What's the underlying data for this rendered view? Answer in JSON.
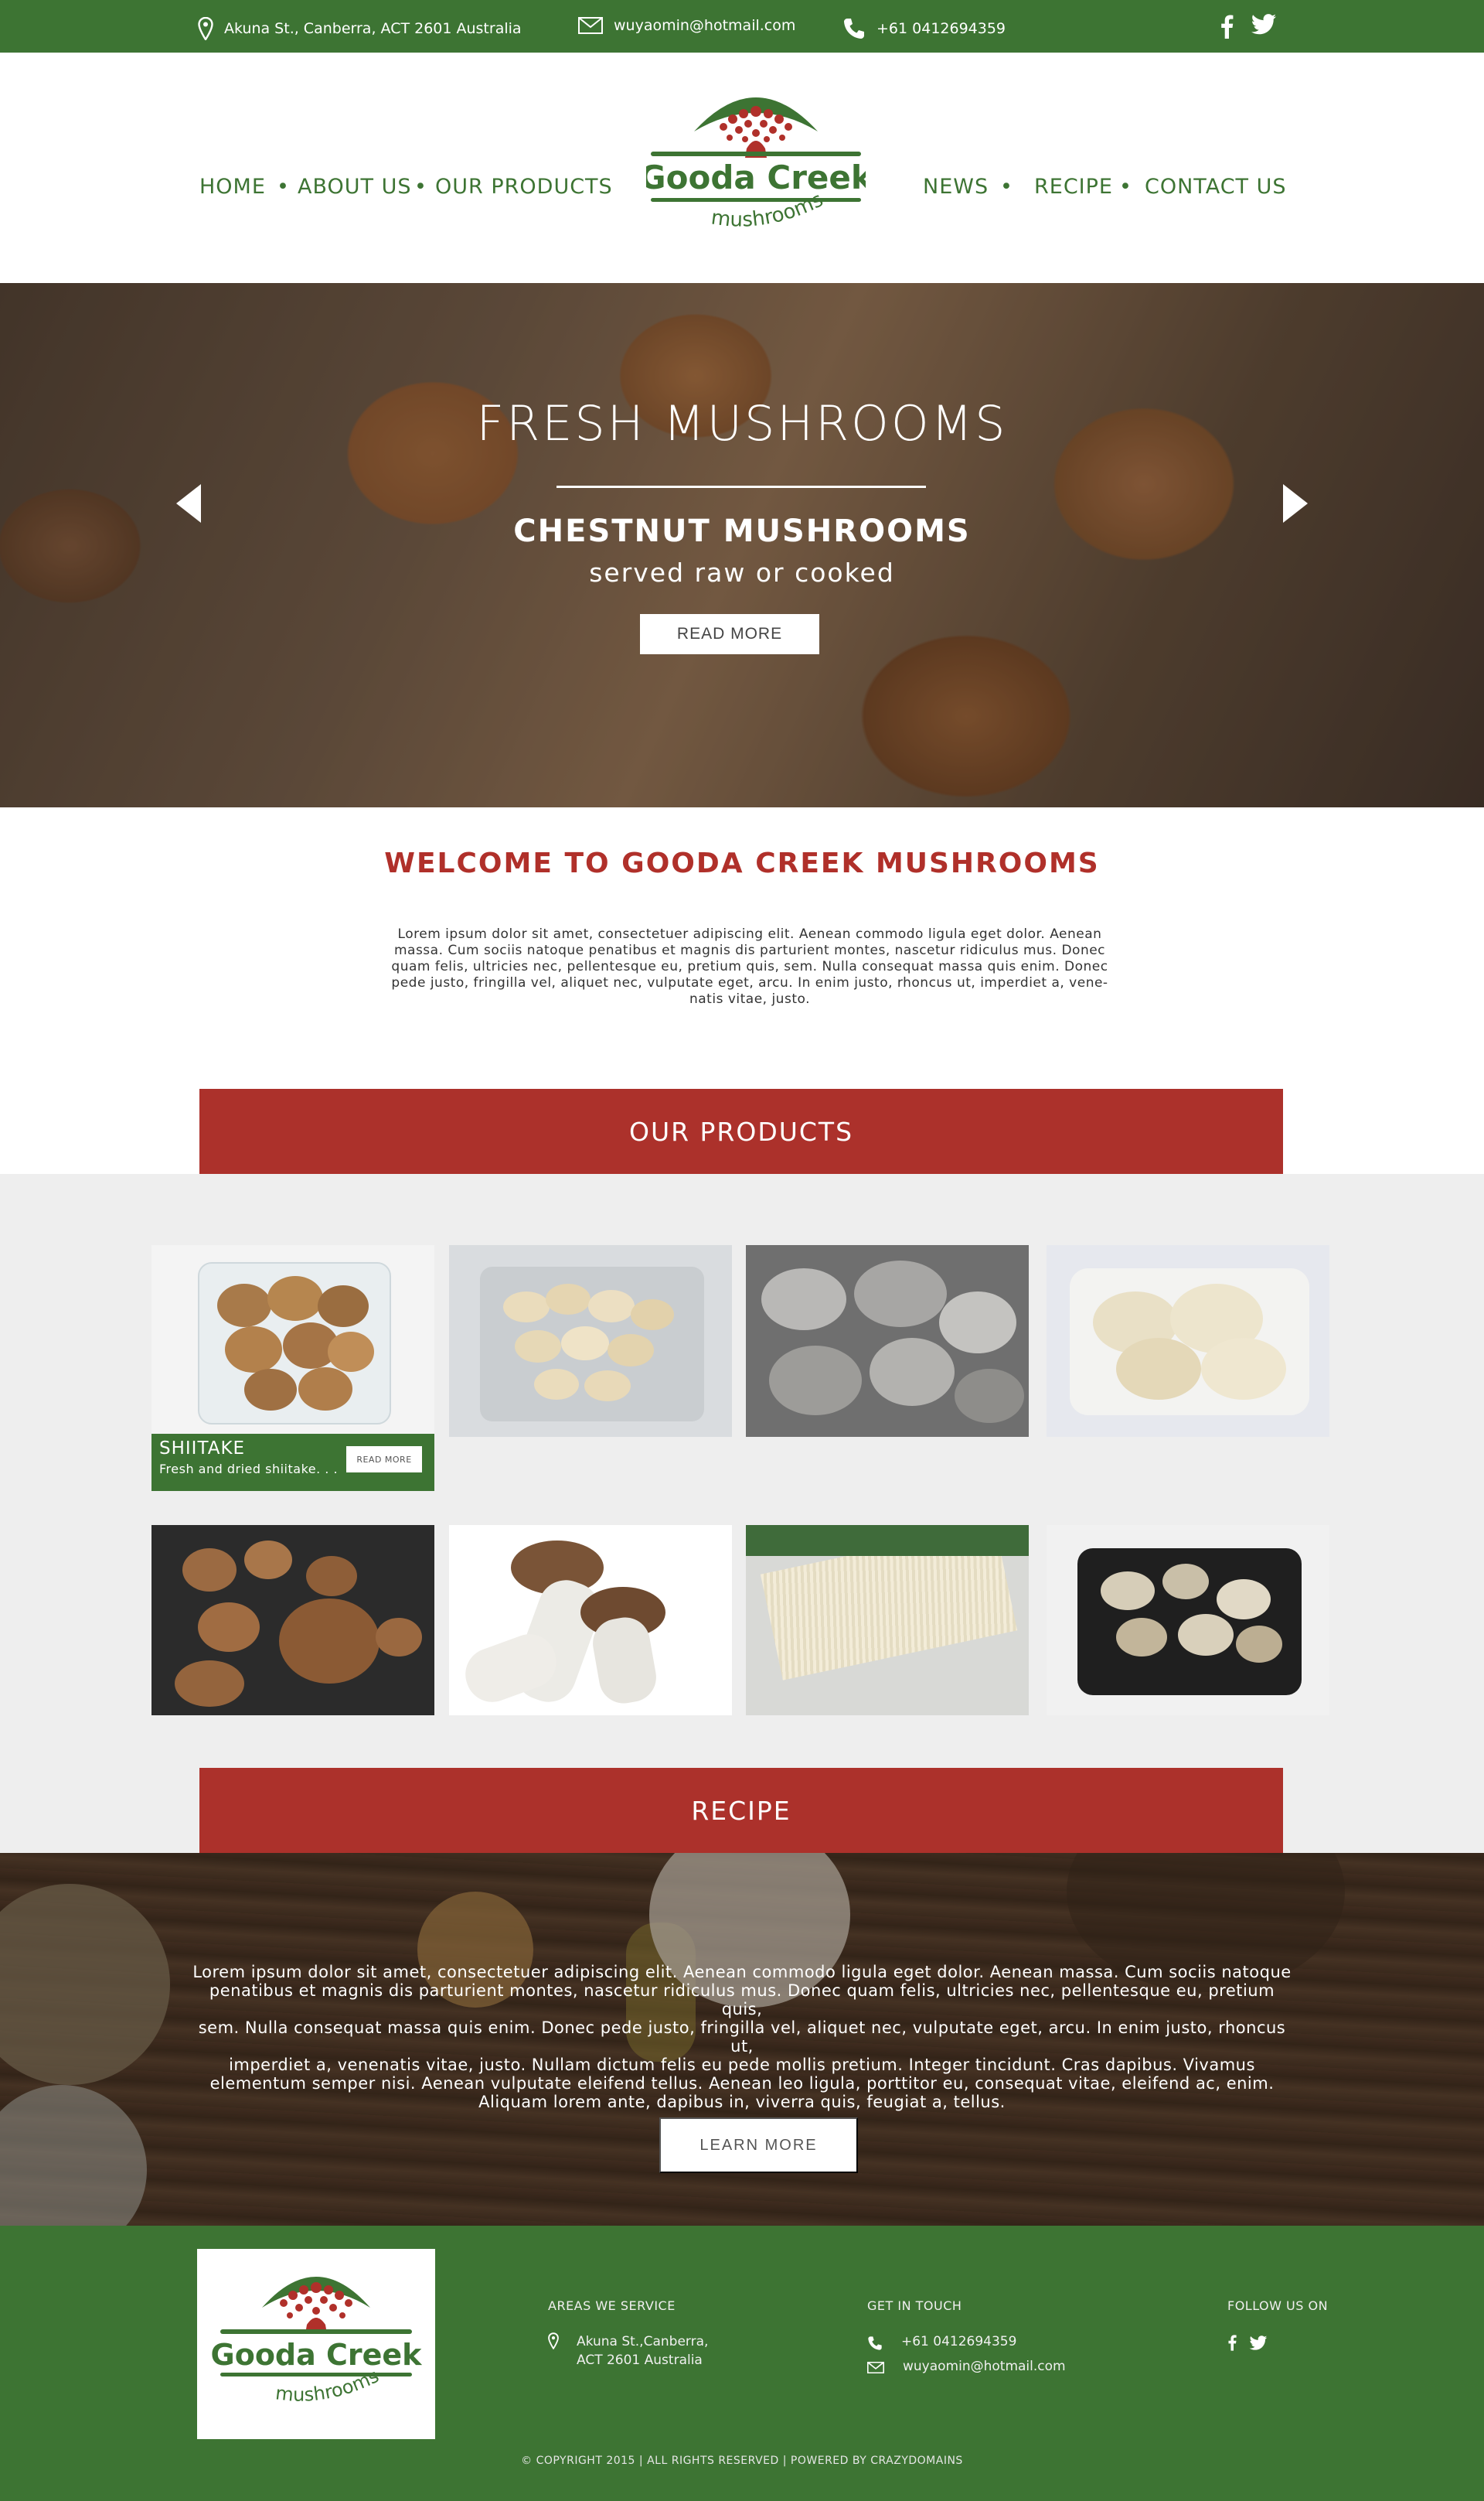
{
  "topbar": {
    "address": "Akuna St., Canberra, ACT 2601 Australia",
    "email": "wuyaomin@hotmail.com",
    "phone": "+61 0412694359"
  },
  "nav": {
    "left": [
      "HOME",
      "ABOUT US",
      "OUR PRODUCTS"
    ],
    "right": [
      "NEWS",
      "RECIPE",
      "CONTACT US"
    ]
  },
  "logo": {
    "title": "Gooda Creek",
    "subtitle": "mushrooms"
  },
  "hero": {
    "title": "FRESH MUSHROOMS",
    "subtitle": "CHESTNUT MUSHROOMS",
    "tagline": "served raw or cooked",
    "button": "READ MORE"
  },
  "welcome": {
    "title": "WELCOME TO GOODA CREEK MUSHROOMS",
    "lines": [
      "Lorem ipsum dolor sit amet, consectetuer adipiscing elit. Aenean commodo ligula eget dolor. Aenean",
      "massa. Cum sociis natoque penatibus et magnis dis parturient montes, nascetur ridiculus mus. Donec",
      "quam felis, ultricies nec, pellentesque eu, pretium quis, sem. Nulla consequat massa quis enim. Donec",
      "pede justo, fringilla vel, aliquet nec, vulputate eget, arcu. In enim justo, rhoncus ut, imperdiet a, vene-",
      "natis vitae, justo."
    ]
  },
  "products": {
    "heading": "OUR PRODUCTS",
    "featured": {
      "name": "SHIITAKE",
      "desc": "Fresh and dried shiitake. . .",
      "button": "READ MORE"
    }
  },
  "recipe": {
    "heading": "RECIPE",
    "lines": [
      "Lorem ipsum dolor sit amet, consectetuer adipiscing elit. Aenean commodo ligula eget dolor. Aenean massa. Cum sociis natoque",
      "penatibus et magnis dis parturient montes, nascetur ridiculus mus. Donec quam felis, ultricies nec, pellentesque eu, pretium quis,",
      "sem. Nulla consequat massa quis enim. Donec pede justo, fringilla vel, aliquet nec, vulputate eget, arcu. In enim justo, rhoncus ut,",
      "imperdiet a, venenatis vitae, justo. Nullam dictum felis eu pede mollis pretium. Integer tincidunt. Cras dapibus. Vivamus",
      "elementum semper nisi. Aenean vulputate eleifend tellus. Aenean leo ligula, porttitor eu, consequat vitae, eleifend ac, enim.",
      "Aliquam lorem ante, dapibus in, viverra quis, feugiat a, tellus."
    ],
    "button": "LEARN MORE"
  },
  "footer": {
    "areas_heading": "AREAS WE SERVICE",
    "address_line1": "Akuna St.,Canberra,",
    "address_line2": "ACT 2601 Australia",
    "contact_heading": "GET IN TOUCH",
    "phone": "+61 0412694359",
    "email": "wuyaomin@hotmail.com",
    "follow_heading": "FOLLOW US ON",
    "copyright": "© COPYRIGHT 2015 | ALL RIGHTS RESERVED | POWERED BY CRAZYDOMAINS"
  },
  "colors": {
    "brand_green": "#3d7433",
    "brand_red": "#ac312b",
    "welcome_red": "#b0302a"
  }
}
